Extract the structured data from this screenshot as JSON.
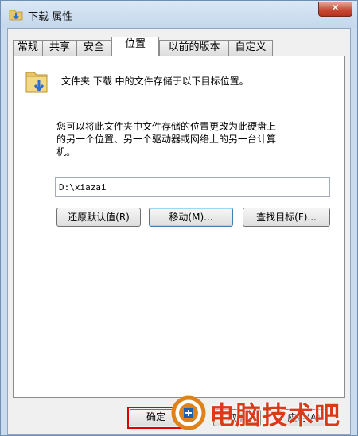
{
  "window": {
    "title": "下载 属性",
    "close_label": "✕"
  },
  "tabs": [
    {
      "label": "常规"
    },
    {
      "label": "共享"
    },
    {
      "label": "安全"
    },
    {
      "label": "位置"
    },
    {
      "label": "以前的版本"
    },
    {
      "label": "自定义"
    }
  ],
  "active_tab": "位置",
  "panel": {
    "description": "文件夹 下载 中的文件存储于以下目标位置。",
    "explanation_line1": "您可以将此文件夹中文件存储的位置更改为此硬盘上",
    "explanation_line2": "的另一个位置、另一个驱动器或网络上的另一台计算",
    "explanation_line3": "机。",
    "path_value": "D:\\xiazai",
    "restore_button": "还原默认值(R)",
    "move_button": "移动(M)...",
    "find_target_button": "查找目标(F)..."
  },
  "footer": {
    "ok_button": "确定",
    "cancel_button": "取消",
    "apply_button": "应用(A)"
  },
  "watermark": {
    "text": "电脑技术吧"
  },
  "colors": {
    "window_frame": "#c9dbee",
    "close_button": "#c74a35",
    "highlight_border": "#e00000",
    "watermark_text": "#d83a1a",
    "folder": "#e8c46a"
  },
  "icons": {
    "title": "folder-download-icon",
    "panel": "folder-download-icon",
    "close": "close-icon",
    "watermark": "brand-logo-icon"
  }
}
